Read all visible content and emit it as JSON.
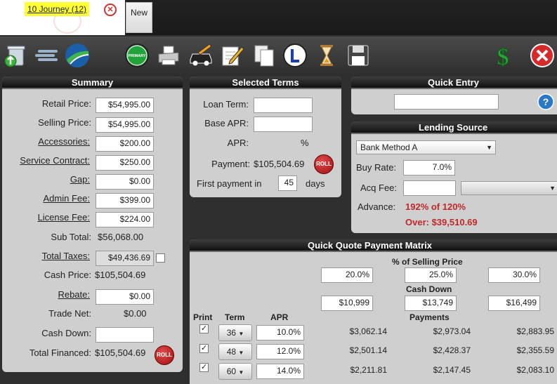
{
  "tabs": {
    "active_label": "10 Journey  (12)",
    "new_label": "New"
  },
  "toolbar": {
    "primary_label": "PRIMARY"
  },
  "summary": {
    "title": "Summary",
    "retail_price_label": "Retail Price:",
    "retail_price_value": "$54,995.00",
    "selling_price_label": "Selling Price:",
    "selling_price_value": "$54,995.00",
    "accessories_label": "Accessories:",
    "accessories_value": "$200.00",
    "service_contract_label": "Service Contract:",
    "service_contract_value": "$250.00",
    "gap_label": "Gap:",
    "gap_value": "$0.00",
    "admin_fee_label": "Admin Fee:",
    "admin_fee_value": "$399.00",
    "license_fee_label": "License Fee:",
    "license_fee_value": "$224.00",
    "sub_total_label": "Sub Total:",
    "sub_total_value": "$56,068.00",
    "total_taxes_label": "Total Taxes:",
    "total_taxes_value": "$49,436.69",
    "cash_price_label": "Cash Price:",
    "cash_price_value": "$105,504.69",
    "rebate_label": "Rebate:",
    "rebate_value": "$0.00",
    "trade_net_label": "Trade Net:",
    "trade_net_value": "$0.00",
    "cash_down_label": "Cash Down:",
    "cash_down_value": "",
    "total_financed_label": "Total Financed:",
    "total_financed_value": "$105,504.69",
    "roll_label": "ROLL"
  },
  "selected_terms": {
    "title": "Selected Terms",
    "loan_term_label": "Loan Term:",
    "loan_term_value": "",
    "base_apr_label": "Base APR:",
    "base_apr_value": "",
    "apr_label": "APR:",
    "apr_unit": "%",
    "payment_label": "Payment:",
    "payment_value": "$105,504.69",
    "roll_label": "ROLL",
    "first_payment_label": "First payment in",
    "first_payment_value": "45",
    "first_payment_unit": "days"
  },
  "quick_entry": {
    "title": "Quick Entry",
    "value": ""
  },
  "lending_source": {
    "title": "Lending Source",
    "method_selected": "Bank Method A",
    "buy_rate_label": "Buy Rate:",
    "buy_rate_value": "7.0%",
    "acq_fee_label": "Acq Fee:",
    "acq_fee_value": "",
    "acq_fee_select": "",
    "advance_label": "Advance:",
    "advance_value": "192% of 120%",
    "over_value": "Over: $39,510.69"
  },
  "matrix": {
    "title": "Quick Quote Payment Matrix",
    "pct_heading": "% of Selling Price",
    "pct_values": [
      "20.0%",
      "25.0%",
      "30.0%"
    ],
    "cash_down_heading": "Cash Down",
    "cash_down_values": [
      "$10,999",
      "$13,749",
      "$16,499"
    ],
    "print_heading": "Print",
    "term_heading": "Term",
    "apr_heading": "APR",
    "payments_heading": "Payments",
    "rows": [
      {
        "term": "36",
        "apr": "10.0%",
        "payments": [
          "$3,062.14",
          "$2,973.04",
          "$2,883.95"
        ]
      },
      {
        "term": "48",
        "apr": "12.0%",
        "payments": [
          "$2,501.14",
          "$2,428.37",
          "$2,355.59"
        ]
      },
      {
        "term": "60",
        "apr": "14.0%",
        "payments": [
          "$2,211.81",
          "$2,147.45",
          "$2,083.10"
        ]
      }
    ]
  },
  "colors": {
    "panel_bg": "#cfcfcf",
    "header_bg": "#111111",
    "alert_red": "#c0282a",
    "tab_highlight": "#ffff33"
  }
}
